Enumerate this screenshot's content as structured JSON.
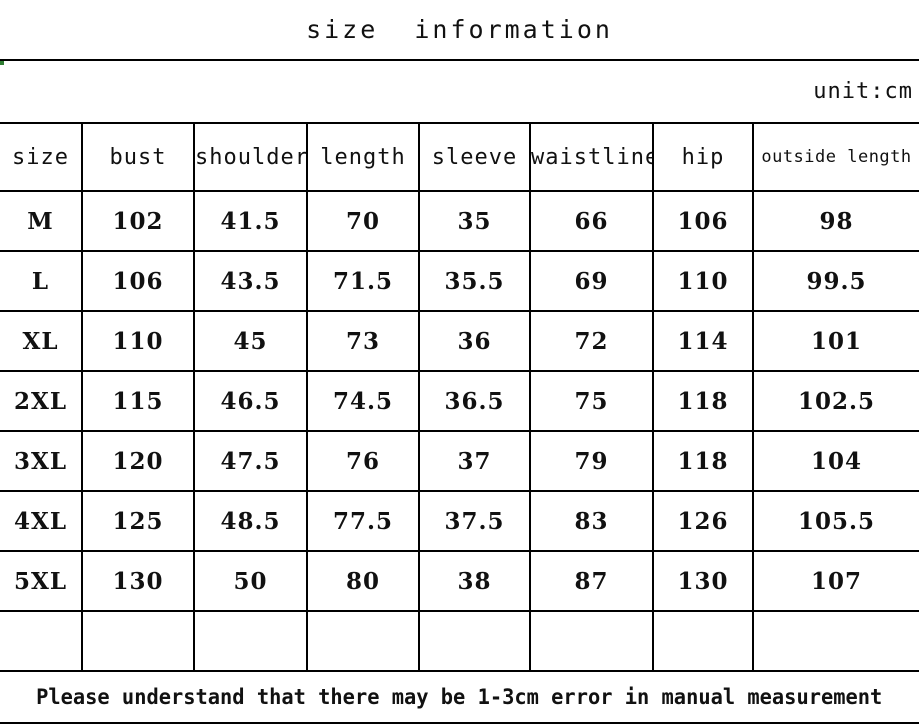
{
  "header": {
    "title": "size  information",
    "unit_label": "unit:cm"
  },
  "table": {
    "columns": [
      "size",
      "bust",
      "shoulder",
      "length",
      "sleeve",
      "waistline",
      "hip",
      "outside length"
    ],
    "rows": [
      {
        "size": "M",
        "bust": "102",
        "shoulder": "41.5",
        "length": "70",
        "sleeve": "35",
        "waistline": "66",
        "hip": "106",
        "outside_length": "98"
      },
      {
        "size": "L",
        "bust": "106",
        "shoulder": "43.5",
        "length": "71.5",
        "sleeve": "35.5",
        "waistline": "69",
        "hip": "110",
        "outside_length": "99.5"
      },
      {
        "size": "XL",
        "bust": "110",
        "shoulder": "45",
        "length": "73",
        "sleeve": "36",
        "waistline": "72",
        "hip": "114",
        "outside_length": "101"
      },
      {
        "size": "2XL",
        "bust": "115",
        "shoulder": "46.5",
        "length": "74.5",
        "sleeve": "36.5",
        "waistline": "75",
        "hip": "118",
        "outside_length": "102.5"
      },
      {
        "size": "3XL",
        "bust": "120",
        "shoulder": "47.5",
        "length": "76",
        "sleeve": "37",
        "waistline": "79",
        "hip": "118",
        "outside_length": "104"
      },
      {
        "size": "4XL",
        "bust": "125",
        "shoulder": "48.5",
        "length": "77.5",
        "sleeve": "37.5",
        "waistline": "83",
        "hip": "126",
        "outside_length": "105.5"
      },
      {
        "size": "5XL",
        "bust": "130",
        "shoulder": "50",
        "length": "80",
        "sleeve": "38",
        "waistline": "87",
        "hip": "130",
        "outside_length": "107"
      }
    ],
    "empty_row": {
      "size": "",
      "bust": "",
      "shoulder": "",
      "length": "",
      "sleeve": "",
      "waistline": "",
      "hip": "",
      "outside_length": ""
    }
  },
  "footer": {
    "note": "Please understand that there may be 1-3cm error in manual measurement"
  },
  "chart_data": {
    "type": "table",
    "title": "size  information",
    "units": "cm",
    "categories": [
      "M",
      "L",
      "XL",
      "2XL",
      "3XL",
      "4XL",
      "5XL"
    ],
    "series": [
      {
        "name": "bust",
        "values": [
          102,
          106,
          110,
          115,
          120,
          125,
          130
        ]
      },
      {
        "name": "shoulder",
        "values": [
          41.5,
          43.5,
          45,
          46.5,
          47.5,
          48.5,
          50
        ]
      },
      {
        "name": "length",
        "values": [
          70,
          71.5,
          73,
          74.5,
          76,
          77.5,
          80
        ]
      },
      {
        "name": "sleeve",
        "values": [
          35,
          35.5,
          36,
          36.5,
          37,
          37.5,
          38
        ]
      },
      {
        "name": "waistline",
        "values": [
          66,
          69,
          72,
          75,
          79,
          83,
          87
        ]
      },
      {
        "name": "hip",
        "values": [
          106,
          110,
          114,
          118,
          118,
          126,
          130
        ]
      },
      {
        "name": "outside length",
        "values": [
          98,
          99.5,
          101,
          102.5,
          104,
          105.5,
          107
        ]
      }
    ],
    "annotations": [
      "unit:cm",
      "Please understand that there may be 1-3cm error in manual measurement"
    ]
  },
  "style": {
    "border_color": "#000000",
    "text_color": "#111111",
    "background": "#ffffff"
  }
}
